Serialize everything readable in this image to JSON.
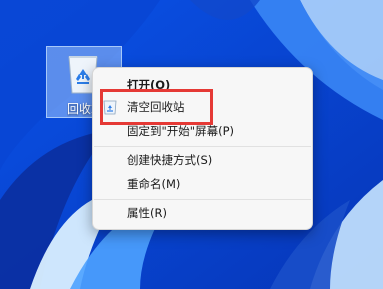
{
  "desktop": {
    "recycle_bin_label": "回收站"
  },
  "context_menu": {
    "items": [
      {
        "label": "打开(O)",
        "icon": "none"
      },
      {
        "label": "清空回收站",
        "icon": "recycle-bin-icon"
      },
      {
        "label": "固定到\"开始\"屏幕(P)",
        "icon": "none"
      },
      {
        "label": "创建快捷方式(S)",
        "icon": "none"
      },
      {
        "label": "重命名(M)",
        "icon": "none"
      },
      {
        "label": "属性(R)",
        "icon": "none"
      }
    ]
  },
  "colors": {
    "wallpaper_blue": "#0b3fd6",
    "highlight_red": "#e53935"
  }
}
